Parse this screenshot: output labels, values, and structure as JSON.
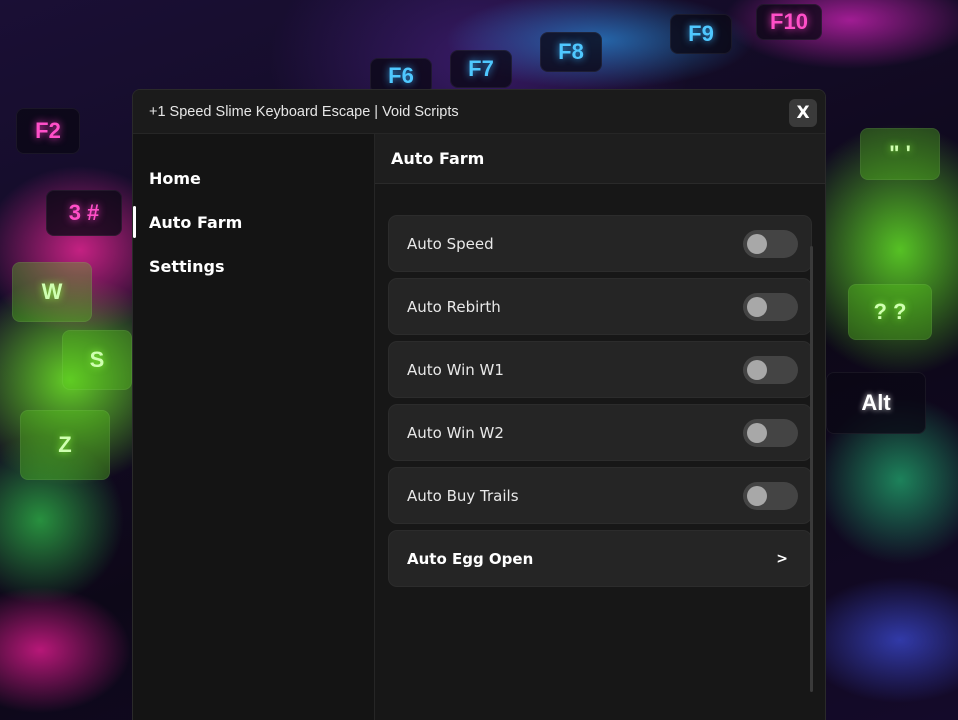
{
  "window": {
    "title": "+1 Speed Slime Keyboard Escape | Void Scripts",
    "close_label": "X"
  },
  "sidebar": {
    "items": [
      {
        "label": "Home",
        "active": false
      },
      {
        "label": "Auto Farm",
        "active": true
      },
      {
        "label": "Settings",
        "active": false
      }
    ]
  },
  "main": {
    "header": "Auto Farm",
    "rows": [
      {
        "label": "Auto Speed",
        "type": "toggle",
        "enabled": false
      },
      {
        "label": "Auto Rebirth",
        "type": "toggle",
        "enabled": false
      },
      {
        "label": "Auto Win W1",
        "type": "toggle",
        "enabled": false
      },
      {
        "label": "Auto Win W2",
        "type": "toggle",
        "enabled": false
      },
      {
        "label": "Auto Buy Trails",
        "type": "toggle",
        "enabled": false
      },
      {
        "label": "Auto Egg Open",
        "type": "nav",
        "chevron": ">"
      }
    ]
  },
  "background": {
    "keys": [
      "F2",
      "F6",
      "F7",
      "F8",
      "F9",
      "F10",
      "3 #",
      "W",
      "S",
      "Z",
      "Alt",
      "? ?",
      "\" '"
    ]
  },
  "colors": {
    "window_bg": "#171717",
    "row_bg": "#252525",
    "toggle_off": "#444444",
    "text": "#ffffff"
  }
}
